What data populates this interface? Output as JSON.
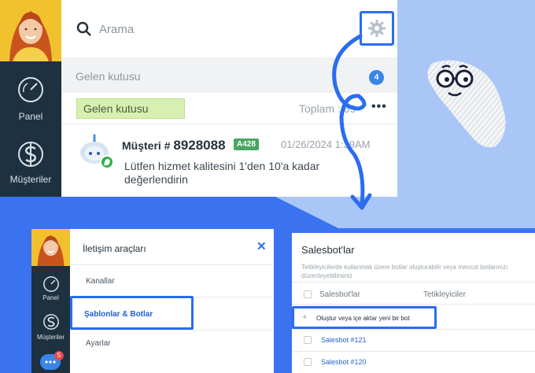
{
  "colors": {
    "accent": "#2a6df0",
    "sidebar": "#1e3140",
    "badge": "#3a86e8",
    "tag": "#4aa664"
  },
  "top": {
    "sidebar": [
      {
        "label": "Panel",
        "icon": "speedometer-icon"
      },
      {
        "label": "Müşteriler",
        "icon": "dollar-icon"
      }
    ],
    "search": {
      "placeholder": "Arama"
    },
    "inbox": {
      "title": "Gelen kutusu",
      "count": "4"
    },
    "filter": {
      "label": "Gelen kutusu",
      "total": "Toplam : 69",
      "more": "•••"
    },
    "message": {
      "name_prefix": "Müşteri #",
      "number": "8928088",
      "tag": "A428",
      "time": "01/26/2024 1:39AM",
      "text": "Lütfen hizmet kalitesini 1'den 10'a kadar değerlendirin"
    }
  },
  "bottom": {
    "sidebar": [
      {
        "label": "Panel",
        "icon": "speedometer-icon"
      },
      {
        "label": "Müşteriler",
        "icon": "dollar-icon"
      }
    ],
    "chat_badge": "5",
    "comm": {
      "title": "İletişim araçları",
      "close": "✕",
      "items": [
        "Kanallar",
        "Şablonlar & Botlar",
        "Ayarlar"
      ]
    },
    "bots": {
      "title": "Salesbot'lar",
      "description": "Tetikleyicilerde kullanmak üzere botlar oluşturabilir veya mevcut botlarınızı düzenleyebilirsiniz",
      "columns": [
        "Salesbot'lar",
        "Tetikleyiciler"
      ],
      "create": "Oluştur veya içe aktar yeni bir bot",
      "create_plus": "+",
      "rows": [
        "Salesbot #121",
        "Salesbot #120"
      ]
    }
  }
}
